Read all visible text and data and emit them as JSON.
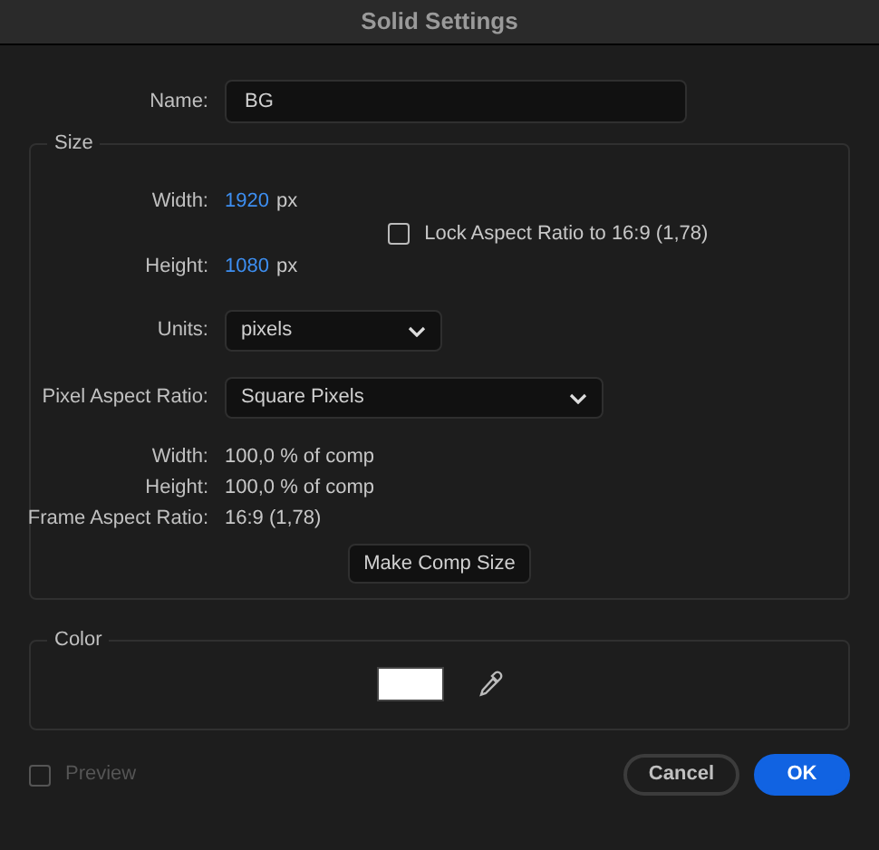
{
  "window": {
    "title": "Solid Settings"
  },
  "name": {
    "label": "Name:",
    "value": "BG"
  },
  "size": {
    "legend": "Size",
    "width": {
      "label": "Width:",
      "value": "1920",
      "unit": "px"
    },
    "height": {
      "label": "Height:",
      "value": "1080",
      "unit": "px"
    },
    "lock": {
      "label": "Lock Aspect Ratio to 16:9 (1,78)",
      "checked": false
    },
    "units": {
      "label": "Units:",
      "value": "pixels"
    },
    "pixel_aspect": {
      "label": "Pixel Aspect Ratio:",
      "value": "Square Pixels"
    },
    "info": [
      {
        "label": "Width:",
        "value": "100,0 % of comp"
      },
      {
        "label": "Height:",
        "value": "100,0 % of comp"
      },
      {
        "label": "Frame Aspect Ratio:",
        "value": "16:9 (1,78)"
      }
    ],
    "button": "Make Comp Size"
  },
  "color": {
    "legend": "Color",
    "swatch": {
      "color": "#ffffff"
    }
  },
  "preview": {
    "label": "Preview",
    "checked": false,
    "disabled": true
  },
  "buttons": [
    {
      "label": "Cancel",
      "kind": "secondary"
    },
    {
      "label": "OK",
      "kind": "primary"
    }
  ]
}
